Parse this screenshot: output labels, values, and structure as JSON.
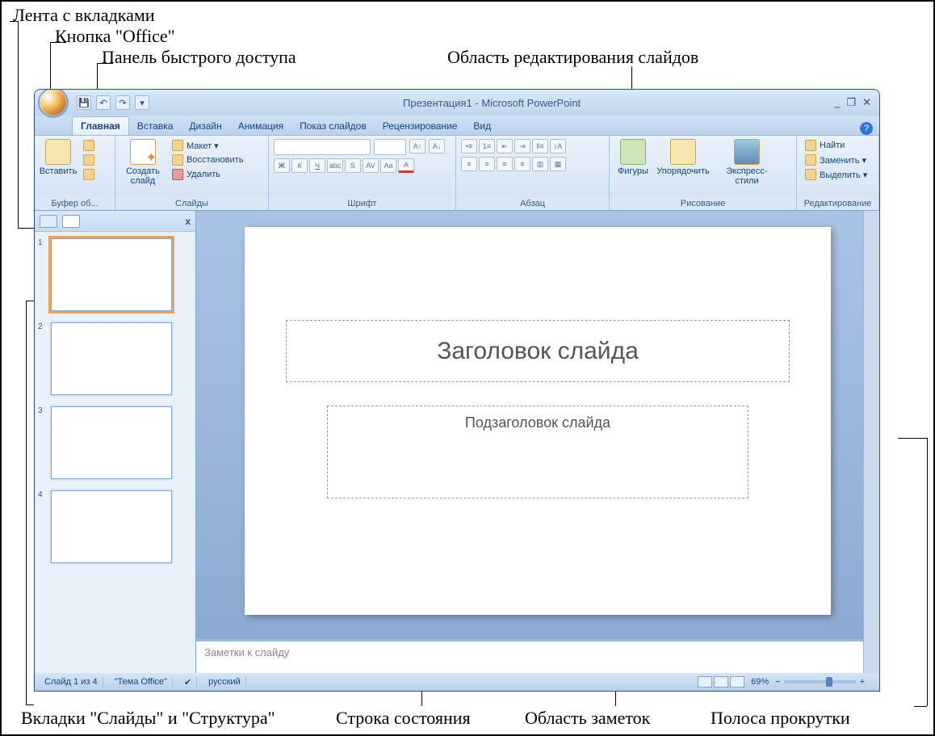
{
  "annotations": {
    "ribbon_with_tabs": "Лента с вкладками",
    "office_button": "Кнопка \"Office\"",
    "qat": "Панель быстрого доступа",
    "slide_edit_area": "Область редактирования слайдов",
    "slides_outline_tabs": "Вкладки \"Слайды\" и \"Структура\"",
    "status_bar": "Строка состояния",
    "notes_area": "Область заметок",
    "scroll_bar": "Полоса прокрутки"
  },
  "titlebar": {
    "title": "Презентация1 - Microsoft PowerPoint",
    "minimize": "_",
    "restore": "❐",
    "close": "✕"
  },
  "qat_icons": {
    "save": "💾",
    "undo": "↶",
    "redo": "↷",
    "more": "▾"
  },
  "tabs": {
    "home": "Главная",
    "insert": "Вставка",
    "design": "Дизайн",
    "animations": "Анимация",
    "slideshow": "Показ слайдов",
    "review": "Рецензирование",
    "view": "Вид"
  },
  "ribbon": {
    "clipboard": {
      "label": "Буфер об...",
      "paste": "Вставить"
    },
    "slides": {
      "label": "Слайды",
      "new_slide": "Создать слайд",
      "layout": "Макет ▾",
      "reset": "Восстановить",
      "delete": "Удалить"
    },
    "font": {
      "label": "Шрифт"
    },
    "paragraph": {
      "label": "Абзац"
    },
    "drawing": {
      "label": "Рисование",
      "shapes": "Фигуры",
      "arrange": "Упорядочить",
      "quick_styles": "Экспресс-стили"
    },
    "editing": {
      "label": "Редактирование",
      "find": "Найти",
      "replace": "Заменить ▾",
      "select": "Выделить ▾"
    }
  },
  "slide": {
    "title_placeholder": "Заголовок слайда",
    "subtitle_placeholder": "Подзаголовок слайда"
  },
  "notes_placeholder": "Заметки к слайду",
  "status": {
    "slide_pos": "Слайд 1 из 4",
    "theme": "\"Тема Office\"",
    "language": "русский",
    "zoom": "69%"
  },
  "thumbs": [
    {
      "n": "1",
      "selected": true
    },
    {
      "n": "2"
    },
    {
      "n": "3"
    },
    {
      "n": "4"
    }
  ]
}
